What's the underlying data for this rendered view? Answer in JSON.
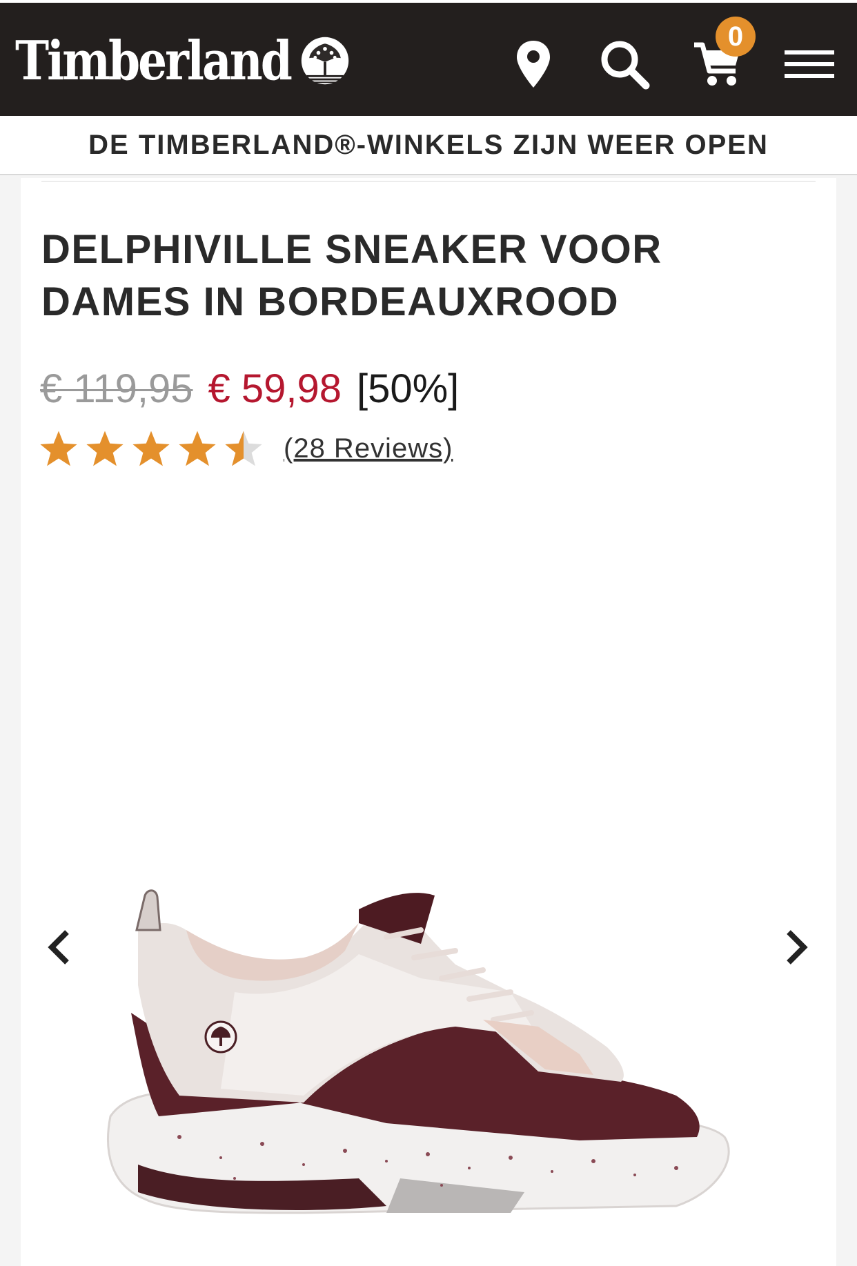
{
  "header": {
    "brand": "Timberland",
    "cart_count": "0",
    "icons": [
      "location-pin-icon",
      "search-icon",
      "cart-icon",
      "hamburger-menu-icon"
    ],
    "background_color": "#231f1e",
    "badge_color": "#e4902c"
  },
  "promo": {
    "text": "DE TIMBERLAND®-WINKELS ZIJN WEER OPEN"
  },
  "product": {
    "title": "DELPHIVILLE SNEAKER VOOR DAMES IN BORDEAUXROOD",
    "price_original": "€ 119,95",
    "price_sale": "€ 59,98",
    "discount": "[50%]",
    "sale_color": "#b5172f",
    "rating": 4.5,
    "rating_max": 5,
    "star_color": "#e4902c",
    "reviews_label": "(28 Reviews)"
  },
  "gallery": {
    "prev_icon": "chevron-left-icon",
    "next_icon": "chevron-right-icon",
    "image_subject": "burgundy-and-white-sneaker"
  }
}
